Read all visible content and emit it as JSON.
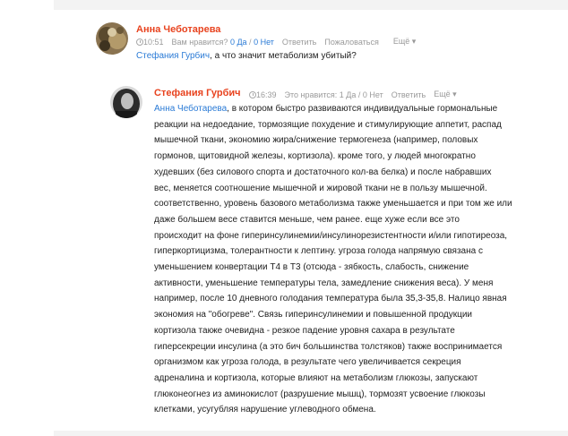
{
  "comment1": {
    "author": "Анна Чеботарева",
    "time": "10:51",
    "like_prompt": "Вам нравится?",
    "yes": "0 Да",
    "separator": " / ",
    "no": "0 Нет",
    "reply": "Ответить",
    "report": "Пожаловаться",
    "more": "Ещё ▾",
    "mention": "Стефания Гурбич",
    "text": ", а что значит метаболизм убитый?"
  },
  "comment2": {
    "author": "Стефания Гурбич",
    "time": "16:39",
    "like_prompt": "Это нравится:",
    "yes": "1 Да",
    "separator": " / ",
    "no": "0 Нет",
    "reply": "Ответить",
    "more": "Ещё ▾",
    "mention": "Анна Чеботарева",
    "lines": [
      ", в котором быстро развиваются индивидуальные гормональные",
      "реакции на недоедание, тормозящие похудение и стимулирующие аппетит, распад",
      "мышечной ткани, экономию жира/снижение термогенеза (например, половых",
      "гормонов, щитовидной железы, кортизола). кроме того, у людей многократно",
      "худевших (без силового спорта и достаточного кол-ва белка) и после набравших",
      "вес, меняется соотношение мышечной и жировой ткани не в пользу мышечной.",
      "соответственно, уровень базового метаболизма также уменьшается и при том же или",
      "даже большем весе ставится меньше, чем ранее. еще хуже если все это",
      "происходит на фоне гиперинсулинемии/инсулинорезистентности и/или гипотиреоза,",
      "гиперкортицизма, толерантности к лептину. угроза голода напрямую связана с",
      "уменьшением конвертации Т4 в Т3 (отсюда - зябкость, слабость, снижение",
      "активности, уменьшение температуры тела, замедление снижения веса). У меня",
      "например, после 10 дневного голодания температура была 35,3-35,8. Налицо явная",
      "экономия на \"обогреве\". Связь гиперинсулинемии и повышенной продукции",
      "кортизола также очевидна - резкое падение уровня сахара в результате",
      "гиперсекреции инсулина (а это бич большинства толстяков) также воспринимается",
      "организмом как угроза голода, в результате чего увеличивается секреция",
      "адреналина и кортизола, которые влияют на метаболизм глюкозы, запускают",
      "глюконеогнез из аминокислот (разрушение мышц), тормозят усвоение глюкозы",
      "клетками, усугубляя нарушение углеводного обмена."
    ]
  }
}
